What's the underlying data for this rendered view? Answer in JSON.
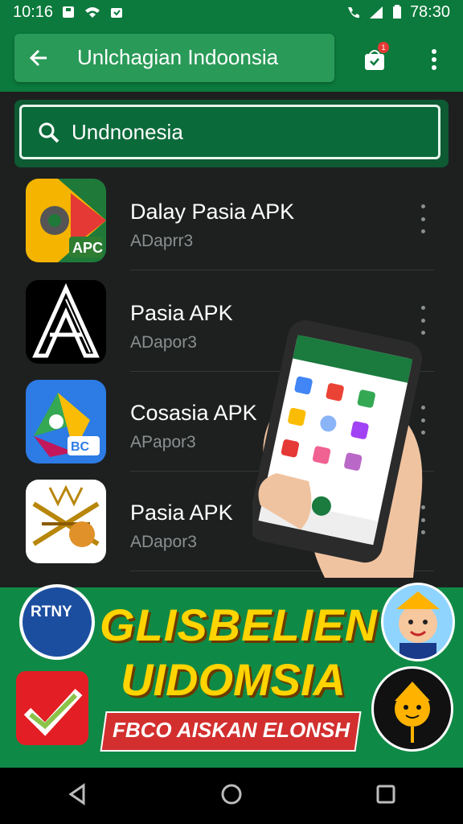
{
  "status_bar": {
    "time": "10:16",
    "time_right": "78:30"
  },
  "app_bar": {
    "title": "Unlchagian Indoonsia",
    "badge_count": "1"
  },
  "search": {
    "query": "Undnonesia"
  },
  "apps": [
    {
      "name": "Dalay Pasia APK",
      "sub": "ADaprr3",
      "icon": "gear-apk-icon"
    },
    {
      "name": "Pasia APK",
      "sub": "ADapor3",
      "icon": "letter-a-logo-icon"
    },
    {
      "name": "Cosasia APK",
      "sub": "APapor3",
      "icon": "blue-apk-icon"
    },
    {
      "name": "Pasia APK",
      "sub": "ADapor3",
      "icon": "ornament-icon"
    }
  ],
  "promo": {
    "line1": "GLISBELIEN",
    "line2": "UIDOMSIA",
    "banner": "FBCO AISKAN ELONSH",
    "badge": "RTNY"
  },
  "colors": {
    "primary": "#0b7a3c",
    "background": "#1e2020",
    "accent_yellow": "#ffd400",
    "accent_red": "#d32f2f"
  }
}
